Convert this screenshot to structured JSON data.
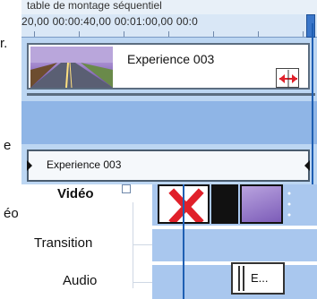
{
  "timeline": {
    "caption": "table de montage séquentiel",
    "ruler_text": "20,00   00:00:40,00   00:01:00,00   00:0",
    "clip": {
      "title": "Experience 003"
    },
    "audio_clip": {
      "title": "Experience 003"
    }
  },
  "background_text": {
    "left_1": "r.",
    "left_2": "e",
    "left_3": "éo"
  },
  "storyboard": {
    "tracks": {
      "video": "Vidéo",
      "transition": "Transition",
      "audio": "Audio"
    },
    "audio_clip_label": "E..."
  },
  "colors": {
    "timeline_background": "#bcd6f2",
    "playhead": "#1f5fb3",
    "trim_arrow": "#e0202a",
    "delete_x": "#e0202a"
  }
}
